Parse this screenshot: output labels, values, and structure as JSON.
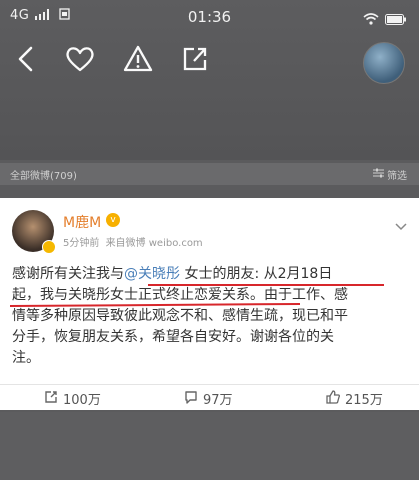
{
  "status_bar": {
    "network": "4G",
    "time": "01:36"
  },
  "filter_bar": {
    "all_posts": "全部微博(709)",
    "filter_label": "筛选"
  },
  "post": {
    "username": "M鹿M",
    "time": "5分钟前",
    "source": "来自微博 weibo.com",
    "text_lines": [
      {
        "before": "感谢所有关注我与",
        "mention": "@关晓彤",
        "after": " 女士的朋友: 从2月18日"
      },
      {
        "text": "起，我与关晓彤女士正式终止恋爱关系。由于工作、感"
      },
      {
        "text": "情等多种原因导致彼此观念不和、感情生疏，现已和平"
      },
      {
        "text": "分手，恢复朋友关系，希望各自安好。谢谢各位的关"
      },
      {
        "text": "注。"
      }
    ],
    "actions": {
      "repost": "100万",
      "comment": "97万",
      "like": "215万"
    }
  },
  "colors": {
    "username": "#e47f2d",
    "mention": "#4a7fb8",
    "underline": "#d7262b"
  }
}
